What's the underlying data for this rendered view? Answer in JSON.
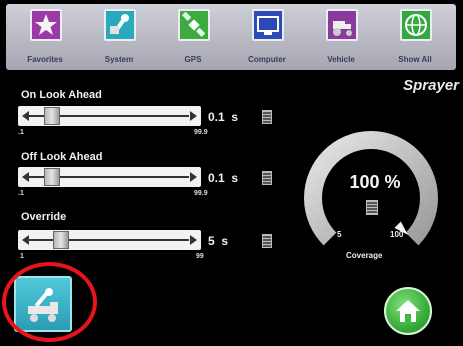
{
  "categories": [
    {
      "label": "Favorites",
      "icon": "star-icon",
      "color": "#9b3aa7"
    },
    {
      "label": "System",
      "icon": "wrench-icon",
      "color": "#2aa9bd"
    },
    {
      "label": "GPS",
      "icon": "satellite-icon",
      "color": "#3dab3d"
    },
    {
      "label": "Computer",
      "icon": "monitor-icon",
      "color": "#2c4bb7"
    },
    {
      "label": "Vehicle",
      "icon": "tractor-icon",
      "color": "#8a3a9c"
    },
    {
      "label": "Show All",
      "icon": "globe-icon",
      "color": "#31a940"
    }
  ],
  "title": "Sprayer",
  "sliders": [
    {
      "label": "On Look Ahead",
      "value": "0.1",
      "unit": "s",
      "min": ".1",
      "max": "99.9",
      "level": 0.1
    },
    {
      "label": "Off Look Ahead",
      "value": "0.1",
      "unit": "s",
      "min": ".1",
      "max": "99.9",
      "level": 0.1
    },
    {
      "label": "Override",
      "value": "5",
      "unit": "s",
      "min": "1",
      "max": "99",
      "level": 0.16
    }
  ],
  "coverage": {
    "value": "100 %",
    "min": "5",
    "max": "100",
    "label": "Coverage",
    "level": 1.0
  },
  "colors": {
    "highlight": "#e8141b",
    "setup_button": "#3fb6c9",
    "home_button": "#3fb83c"
  },
  "buttons": {
    "setup_icon": "wrench-sprayer-icon",
    "home_icon": "home-icon"
  }
}
